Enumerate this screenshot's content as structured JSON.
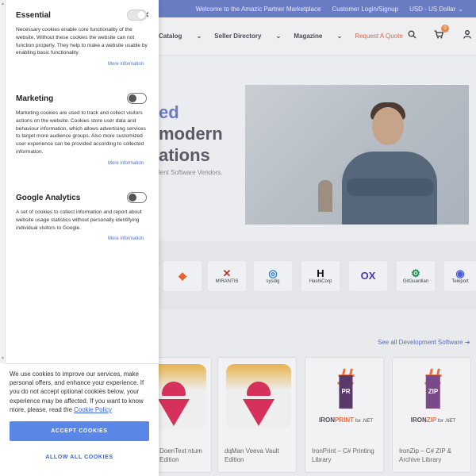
{
  "site": {
    "topbar": {
      "welcome": "Welcome to the Amazic Partner Marketplace",
      "login": "Customer Login/Signup",
      "currency": "USD - US Dollar"
    },
    "nav": {
      "catalog": "Catalog",
      "seller_directory": "Seller Directory",
      "magazine": "Magazine",
      "request_quote": "Request A Quote"
    },
    "cart_count": "0",
    "hero": {
      "line1": "ed",
      "line2": "modern",
      "line3": "ations",
      "subtitle": "lent Software Vendors."
    },
    "logos": [
      {
        "mark": "◆",
        "name": ""
      },
      {
        "mark": "✕",
        "name": "MIRANTIS"
      },
      {
        "mark": "◎",
        "name": "sysdig"
      },
      {
        "mark": "H",
        "name": "HashiCorp"
      },
      {
        "mark": "OX",
        "name": ""
      },
      {
        "mark": "⚙",
        "name": "GitGuardian"
      },
      {
        "mark": "◉",
        "name": "Teleport"
      }
    ],
    "browse_link": "See all Development Software",
    "cards": [
      {
        "title": "DoenText ntum Edition"
      },
      {
        "title": "dqMan Veeva Vault Edition"
      },
      {
        "title": "IronPrint – C# Printing Library",
        "badge": "PR",
        "brand_a": "IRON",
        "brand_b": "PRINT",
        "suffix": " for .NET"
      },
      {
        "title": "IronZip – C# ZIP & Archive Library",
        "badge": "ZIP",
        "brand_a": "IRON",
        "brand_b": "ZIP",
        "suffix": " for .NET"
      }
    ]
  },
  "cookie_panel": {
    "sections": [
      {
        "title": "Essential",
        "enabled": true,
        "description": "Necessary cookies enable core functionality of the website. Without these cookies the website can not function properly. They help to make a website usable by enabling basic functionality.",
        "more": "More information"
      },
      {
        "title": "Marketing",
        "enabled": false,
        "description": "Marketing cookies are used to track and collect visitors actions on the website. Cookies store user data and behaviour information, which allows advertising services to target more audience groups. Also more customized user experience can be provided according to collected information.",
        "more": "More information"
      },
      {
        "title": "Google Analytics",
        "enabled": false,
        "description": "A set of cookies to collect information and report about website usage statistics without personally identifying individual visitors to Google.",
        "more": "More information"
      }
    ],
    "notice_text": "We use cookies to improve our services, make personal offers, and enhance your experience. If you do not accept optional cookies below, your experience may be affected. If you want to know more, please, read the ",
    "policy_link": "Cookie Policy",
    "accept_label": "ACCEPT COOKIES",
    "allow_all_label": "ALLOW ALL COOKIES",
    "close_symbol": "×"
  }
}
